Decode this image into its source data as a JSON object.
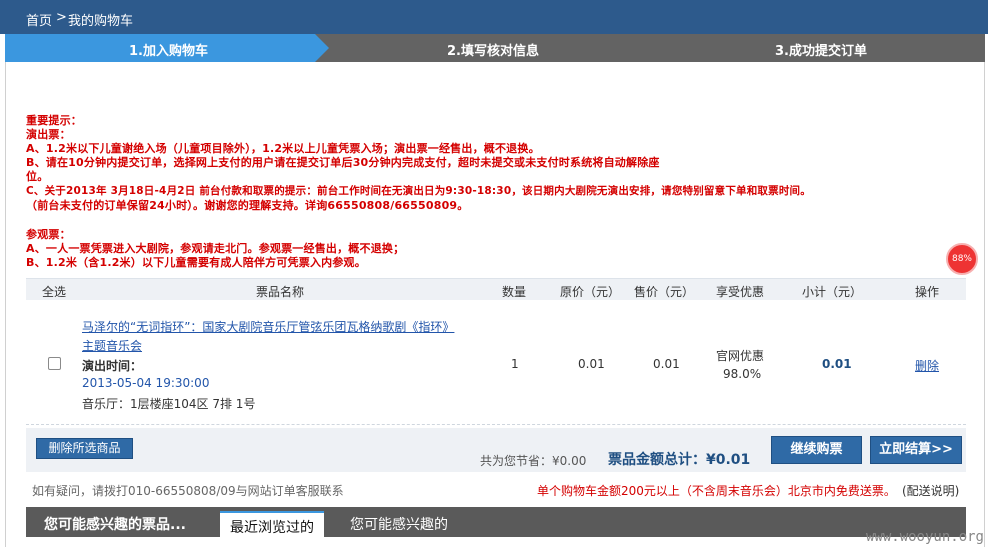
{
  "breadcrumb": {
    "home": "首页",
    "separator": ">",
    "current": "我的购物车"
  },
  "steps": [
    "1.加入购物车",
    "2.填写核对信息",
    "3.成功提交订单"
  ],
  "notices": [
    "重要提示：",
    "演出票：",
    "A、1.2米以下儿童谢绝入场（儿童项目除外），1.2米以上儿童凭票入场；演出票一经售出，概不退换。",
    "B、请在10分钟内提交订单，选择网上支付的用户请在提交订单后30分钟内完成支付，超时未提交或未支付时系统将自动解除座",
    "位。",
    "C、关于2013年 3月18日-4月2日 前台付款和取票的提示：前台工作时间在无演出日为9:30-18:30，该日期内大剧院无演出安排，请您特别留意下单和取票时间。",
    "（前台未支付的订单保留24小时）。谢谢您的理解支持。详询66550808/66550809。",
    "参观票：",
    "A、一人一票凭票进入大剧院，参观请走北门。参观票一经售出，概不退换；",
    "B、1.2米（含1.2米）以下儿童需要有成人陪伴方可凭票入内参观。"
  ],
  "badge": "88%",
  "table": {
    "headers": [
      "全选",
      "票品名称",
      "数量",
      "原价（元）",
      "售价（元）",
      "享受优惠",
      "小计（元）",
      "操作"
    ],
    "row": {
      "title_line1": "马泽尔的“无词指环”：国家大剧院音乐厅管弦乐团瓦格纳歌剧《指环》",
      "title_line2": "主题音乐会",
      "time_label": "演出时间：",
      "time_value": "2013-05-04 19:30:00",
      "venue": "音乐厅：1层楼座104区 7排 1号",
      "quantity": "1",
      "original_price": "0.01",
      "sale_price": "0.01",
      "discount_line1": "官网优惠",
      "discount_line2": "98.0%",
      "subtotal": "0.01",
      "action": "删除"
    }
  },
  "summary": {
    "delete_selected": "删除所选商品",
    "saved": "共为您节省：¥0.00",
    "total": "票品金额总计：¥0.01",
    "continue": "继续购票",
    "checkout": "立即结算>>"
  },
  "footer": {
    "help": "如有疑问，请拨打010-66550808/09与网站订单客服联系",
    "shipping": "单个购物车金额200元以上（不含周末音乐会）北京市内免费送票。",
    "shipping_link": "(配送说明)"
  },
  "tabs": [
    "您可能感兴趣的票品...",
    "最近浏览过的",
    "您可能感兴趣的"
  ],
  "watermark": "www.wooyun.org",
  "colors": {
    "accent": "#3b97df",
    "header": "#2d5a8c",
    "notice": "#d40000"
  }
}
